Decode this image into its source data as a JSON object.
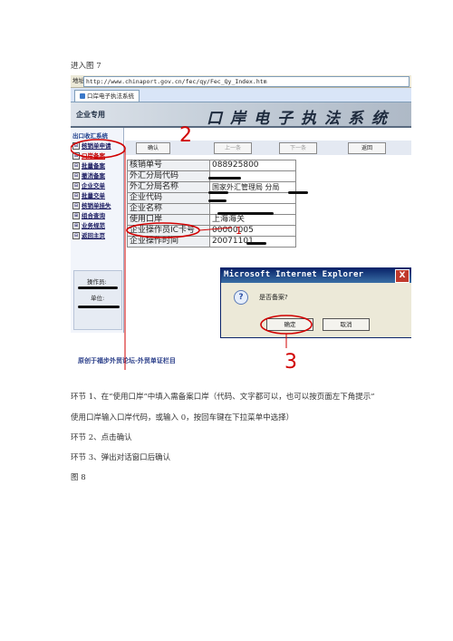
{
  "intro_line": "进入图 7",
  "screenshot": {
    "address_label": "地址",
    "address_url": "http://www.chinaport.gov.cn/fec/qy/Fec_Qy_Index.htm",
    "tab_label": "口岸电子执法系统",
    "banner_left": "企业专用",
    "banner_right": "口岸电子执法系统",
    "sidebar": {
      "title": "出口收汇系统",
      "items": [
        {
          "box": "⊟",
          "label": "核销单申请"
        },
        {
          "box": "⊟",
          "label": "口岸备案"
        },
        {
          "box": "⊟",
          "label": "批量备案"
        },
        {
          "box": "⊟",
          "label": "撤消备案"
        },
        {
          "box": "⊟",
          "label": "企业交单"
        },
        {
          "box": "⊟",
          "label": "批量交单"
        },
        {
          "box": "⊟",
          "label": "核销单挂失"
        },
        {
          "box": "⊞",
          "label": "组合查询"
        },
        {
          "box": "⊞",
          "label": "业务规范"
        },
        {
          "box": "⊟",
          "label": "返回主页"
        }
      ],
      "operator_label": "操作员:",
      "unit_label": "单位:"
    },
    "buttons": {
      "confirm": "确认",
      "prev": "上一条",
      "next": "下一条",
      "back": "返回"
    },
    "form_rows": [
      {
        "label": "核销单号",
        "value": "088925800"
      },
      {
        "label": "外汇分局代码",
        "value": ""
      },
      {
        "label": "外汇分局名称",
        "value": "国家外汇管理局 分局"
      },
      {
        "label": "企业代码",
        "value": ""
      },
      {
        "label": "企业名称",
        "value": ""
      },
      {
        "label": "使用口岸",
        "value": "上海海关"
      },
      {
        "label": "企业操作员IC卡号",
        "value": "00000005"
      },
      {
        "label": "企业操作时间",
        "value": "20071101"
      }
    ],
    "dialog": {
      "title": "Microsoft Internet Explorer",
      "close": "X",
      "icon": "?",
      "message": "是否备案?",
      "ok": "确定",
      "cancel": "取消"
    },
    "caption": "原创于福步外贸论坛-外贸单证栏目",
    "annotations": {
      "n2": "2",
      "n1": "1",
      "n3": "3"
    }
  },
  "steps": [
    "环节 1、在“使用口岸”中填入需备案口岸（代码、文字都可以，也可以按页面左下角提示”",
    "使用口岸输入口岸代码，或输入 0，按回车键在下拉菜单中选择）",
    "环节 2、点击确认",
    "环节 3、弹出对话窗口后确认"
  ],
  "figure_label": "图 8",
  "colors": {
    "annotation_red": "#d10000",
    "title_bar": "#0a246a",
    "link_blue": "#1a1a60"
  }
}
